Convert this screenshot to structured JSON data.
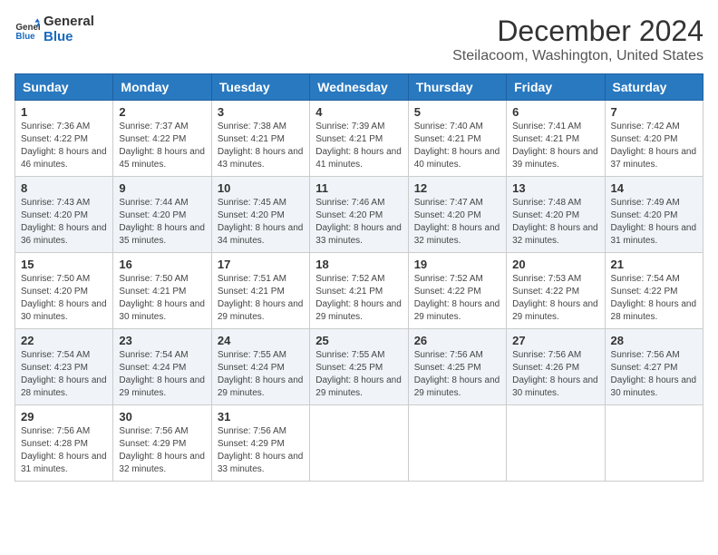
{
  "header": {
    "logo_line1": "General",
    "logo_line2": "Blue",
    "main_title": "December 2024",
    "subtitle": "Steilacoom, Washington, United States"
  },
  "days_of_week": [
    "Sunday",
    "Monday",
    "Tuesday",
    "Wednesday",
    "Thursday",
    "Friday",
    "Saturday"
  ],
  "weeks": [
    [
      {
        "day": "1",
        "sunrise": "7:36 AM",
        "sunset": "4:22 PM",
        "daylight": "8 hours and 46 minutes."
      },
      {
        "day": "2",
        "sunrise": "7:37 AM",
        "sunset": "4:22 PM",
        "daylight": "8 hours and 45 minutes."
      },
      {
        "day": "3",
        "sunrise": "7:38 AM",
        "sunset": "4:21 PM",
        "daylight": "8 hours and 43 minutes."
      },
      {
        "day": "4",
        "sunrise": "7:39 AM",
        "sunset": "4:21 PM",
        "daylight": "8 hours and 41 minutes."
      },
      {
        "day": "5",
        "sunrise": "7:40 AM",
        "sunset": "4:21 PM",
        "daylight": "8 hours and 40 minutes."
      },
      {
        "day": "6",
        "sunrise": "7:41 AM",
        "sunset": "4:21 PM",
        "daylight": "8 hours and 39 minutes."
      },
      {
        "day": "7",
        "sunrise": "7:42 AM",
        "sunset": "4:20 PM",
        "daylight": "8 hours and 37 minutes."
      }
    ],
    [
      {
        "day": "8",
        "sunrise": "7:43 AM",
        "sunset": "4:20 PM",
        "daylight": "8 hours and 36 minutes."
      },
      {
        "day": "9",
        "sunrise": "7:44 AM",
        "sunset": "4:20 PM",
        "daylight": "8 hours and 35 minutes."
      },
      {
        "day": "10",
        "sunrise": "7:45 AM",
        "sunset": "4:20 PM",
        "daylight": "8 hours and 34 minutes."
      },
      {
        "day": "11",
        "sunrise": "7:46 AM",
        "sunset": "4:20 PM",
        "daylight": "8 hours and 33 minutes."
      },
      {
        "day": "12",
        "sunrise": "7:47 AM",
        "sunset": "4:20 PM",
        "daylight": "8 hours and 32 minutes."
      },
      {
        "day": "13",
        "sunrise": "7:48 AM",
        "sunset": "4:20 PM",
        "daylight": "8 hours and 32 minutes."
      },
      {
        "day": "14",
        "sunrise": "7:49 AM",
        "sunset": "4:20 PM",
        "daylight": "8 hours and 31 minutes."
      }
    ],
    [
      {
        "day": "15",
        "sunrise": "7:50 AM",
        "sunset": "4:20 PM",
        "daylight": "8 hours and 30 minutes."
      },
      {
        "day": "16",
        "sunrise": "7:50 AM",
        "sunset": "4:21 PM",
        "daylight": "8 hours and 30 minutes."
      },
      {
        "day": "17",
        "sunrise": "7:51 AM",
        "sunset": "4:21 PM",
        "daylight": "8 hours and 29 minutes."
      },
      {
        "day": "18",
        "sunrise": "7:52 AM",
        "sunset": "4:21 PM",
        "daylight": "8 hours and 29 minutes."
      },
      {
        "day": "19",
        "sunrise": "7:52 AM",
        "sunset": "4:22 PM",
        "daylight": "8 hours and 29 minutes."
      },
      {
        "day": "20",
        "sunrise": "7:53 AM",
        "sunset": "4:22 PM",
        "daylight": "8 hours and 29 minutes."
      },
      {
        "day": "21",
        "sunrise": "7:54 AM",
        "sunset": "4:22 PM",
        "daylight": "8 hours and 28 minutes."
      }
    ],
    [
      {
        "day": "22",
        "sunrise": "7:54 AM",
        "sunset": "4:23 PM",
        "daylight": "8 hours and 28 minutes."
      },
      {
        "day": "23",
        "sunrise": "7:54 AM",
        "sunset": "4:24 PM",
        "daylight": "8 hours and 29 minutes."
      },
      {
        "day": "24",
        "sunrise": "7:55 AM",
        "sunset": "4:24 PM",
        "daylight": "8 hours and 29 minutes."
      },
      {
        "day": "25",
        "sunrise": "7:55 AM",
        "sunset": "4:25 PM",
        "daylight": "8 hours and 29 minutes."
      },
      {
        "day": "26",
        "sunrise": "7:56 AM",
        "sunset": "4:25 PM",
        "daylight": "8 hours and 29 minutes."
      },
      {
        "day": "27",
        "sunrise": "7:56 AM",
        "sunset": "4:26 PM",
        "daylight": "8 hours and 30 minutes."
      },
      {
        "day": "28",
        "sunrise": "7:56 AM",
        "sunset": "4:27 PM",
        "daylight": "8 hours and 30 minutes."
      }
    ],
    [
      {
        "day": "29",
        "sunrise": "7:56 AM",
        "sunset": "4:28 PM",
        "daylight": "8 hours and 31 minutes."
      },
      {
        "day": "30",
        "sunrise": "7:56 AM",
        "sunset": "4:29 PM",
        "daylight": "8 hours and 32 minutes."
      },
      {
        "day": "31",
        "sunrise": "7:56 AM",
        "sunset": "4:29 PM",
        "daylight": "8 hours and 33 minutes."
      },
      null,
      null,
      null,
      null
    ]
  ],
  "labels": {
    "sunrise_prefix": "Sunrise: ",
    "sunset_prefix": "Sunset: ",
    "daylight_prefix": "Daylight: "
  }
}
